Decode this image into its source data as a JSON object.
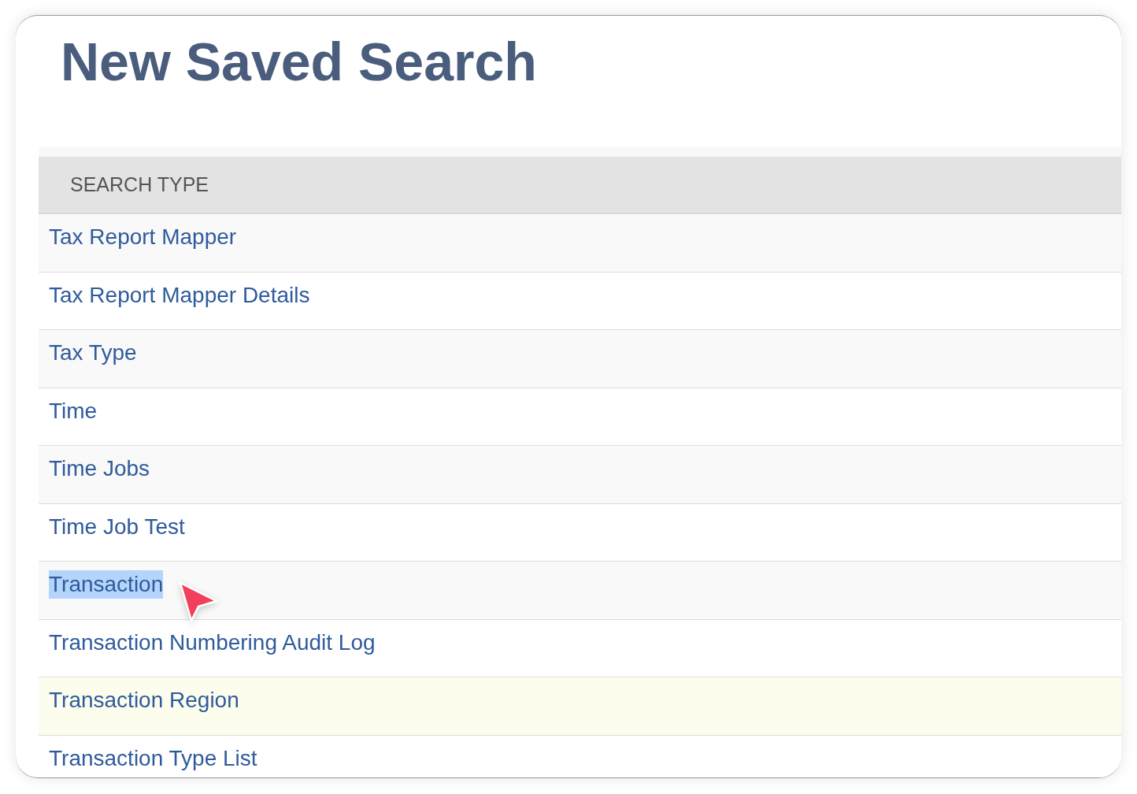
{
  "title": "New Saved Search",
  "table": {
    "columns": [
      "SEARCH TYPE"
    ],
    "rows": [
      {
        "label": "Tax Report Mapper",
        "hovered": false,
        "text_highlighted": false
      },
      {
        "label": "Tax Report Mapper Details",
        "hovered": false,
        "text_highlighted": false
      },
      {
        "label": "Tax Type",
        "hovered": false,
        "text_highlighted": false
      },
      {
        "label": "Time",
        "hovered": false,
        "text_highlighted": false
      },
      {
        "label": "Time Jobs",
        "hovered": false,
        "text_highlighted": false
      },
      {
        "label": "Time Job Test",
        "hovered": false,
        "text_highlighted": false
      },
      {
        "label": "Transaction",
        "hovered": false,
        "text_highlighted": true
      },
      {
        "label": "Transaction Numbering Audit Log",
        "hovered": false,
        "text_highlighted": false
      },
      {
        "label": "Transaction Region",
        "hovered": true,
        "text_highlighted": false
      },
      {
        "label": "Transaction Type List",
        "hovered": false,
        "text_highlighted": false
      }
    ]
  }
}
